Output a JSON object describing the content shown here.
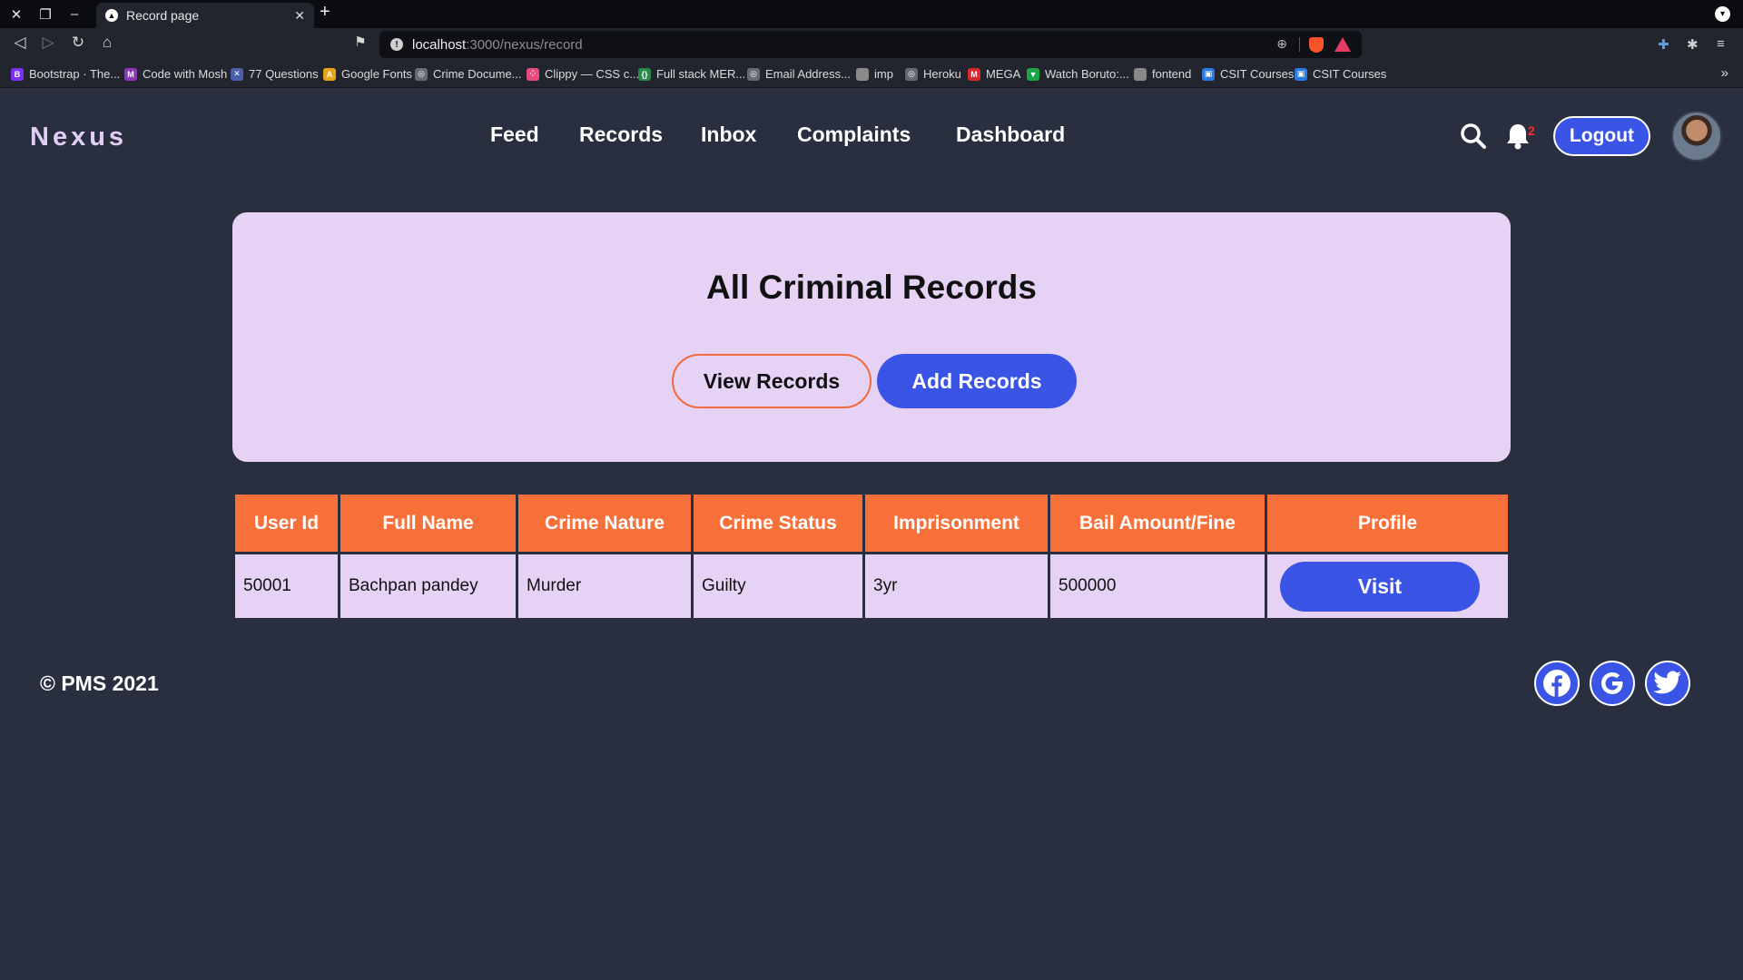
{
  "browser": {
    "tab_title": "Record page",
    "url_host": "localhost",
    "url_path": ":3000/nexus/record",
    "bookmarks": [
      {
        "label": "Bootstrap · The...",
        "icon": "bootstrap-icon",
        "color": "#7b2ff7",
        "glyph": "B"
      },
      {
        "label": "Code with Mosh",
        "icon": "mosh-icon",
        "color": "#8a3ab9",
        "glyph": "M"
      },
      {
        "label": "77 Questions",
        "icon": "questions-icon",
        "color": "#4a5fa8",
        "glyph": "✕"
      },
      {
        "label": "Google Fonts",
        "icon": "google-fonts-icon",
        "color": "#e8a317",
        "glyph": "A"
      },
      {
        "label": "Crime Docume...",
        "icon": "globe-icon",
        "color": "#666a75",
        "glyph": "◎"
      },
      {
        "label": "Clippy — CSS c...",
        "icon": "clippy-icon",
        "color": "#e84a7a",
        "glyph": "⁘"
      },
      {
        "label": "Full stack MER...",
        "icon": "code-icon",
        "color": "#2a8a4a",
        "glyph": "{}"
      },
      {
        "label": "Email Address...",
        "icon": "globe-icon",
        "color": "#666a75",
        "glyph": "◎"
      },
      {
        "label": "imp",
        "icon": "folder-icon",
        "color": "#8a8a8a",
        "glyph": ""
      },
      {
        "label": "Heroku",
        "icon": "globe-icon",
        "color": "#666a75",
        "glyph": "◎"
      },
      {
        "label": "MEGA",
        "icon": "mega-icon",
        "color": "#d9272e",
        "glyph": "M"
      },
      {
        "label": "Watch Boruto:...",
        "icon": "boruto-icon",
        "color": "#1aa34a",
        "glyph": "▼"
      },
      {
        "label": "fontend",
        "icon": "folder-icon",
        "color": "#8a8a8a",
        "glyph": ""
      },
      {
        "label": "CSIT Courses",
        "icon": "csit-icon",
        "color": "#2a7ae2",
        "glyph": "▣"
      },
      {
        "label": "CSIT Courses",
        "icon": "csit-icon",
        "color": "#2a7ae2",
        "glyph": "▣"
      }
    ]
  },
  "app": {
    "brand": "Nexus",
    "nav": [
      "Feed",
      "Records",
      "Inbox",
      "Complaints",
      "Dashboard"
    ],
    "notification_count": "2",
    "logout_label": "Logout"
  },
  "hero": {
    "title": "All Criminal Records",
    "view_label": "View Records",
    "add_label": "Add Records"
  },
  "table": {
    "headers": [
      "User Id",
      "Full Name",
      "Crime Nature",
      "Crime Status",
      "Imprisonment",
      "Bail Amount/Fine",
      "Profile"
    ],
    "rows": [
      {
        "user_id": "50001",
        "full_name": "Bachpan pandey",
        "crime_nature": "Murder",
        "crime_status": "Guilty",
        "imprisonment": "3yr",
        "bail": "500000",
        "profile_label": "Visit"
      }
    ]
  },
  "footer": {
    "copyright": "© PMS 2021",
    "social": [
      "facebook-icon",
      "google-icon",
      "twitter-icon"
    ]
  },
  "colors": {
    "background": "#2a2f40",
    "accent_blue": "#3a55e5",
    "accent_orange": "#f77039",
    "panel_lavender": "#e5d2f5"
  }
}
